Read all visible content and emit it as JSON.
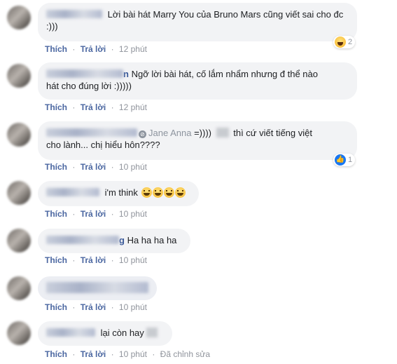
{
  "actions": {
    "like": "Thích",
    "reply": "Trả lời",
    "separator": "·",
    "edited": "Đã chỉnh sửa"
  },
  "comments": [
    {
      "name_suffix": "",
      "text": "Lời bài hát Marry You của Bruno Mars cũng viết sai cho đc :)))",
      "time": "12 phút",
      "reaction": {
        "icon": "haha-reaction-icon",
        "count": "2"
      }
    },
    {
      "name_suffix": "n",
      "text_line1": "Ngỡ lời bài hát, cố lắm nhẩm nhưng đ thể nào",
      "text_line2": "hát cho đúng lời :)))))",
      "time": "12 phút"
    },
    {
      "name_suffix": "",
      "mention": "Jane Anna",
      "text_line1_after": "=)))) ",
      "text_line1_end": " thì cứ viết tiếng việt",
      "text_line2": "cho lành... chị hiểu hôn????",
      "time": "10 phút",
      "reaction": {
        "icon": "like-reaction-icon",
        "count": "1"
      }
    },
    {
      "name_suffix": "",
      "text": "i'm think",
      "time": "10 phút",
      "emoji_count": "4"
    },
    {
      "name_suffix": "g",
      "text": "Ha ha ha ha",
      "time": "10 phút"
    },
    {
      "name_suffix": "",
      "text": "",
      "time": "10 phút"
    },
    {
      "name_suffix": "",
      "text": "lại còn hay",
      "time": "10 phút",
      "edited": true
    }
  ]
}
